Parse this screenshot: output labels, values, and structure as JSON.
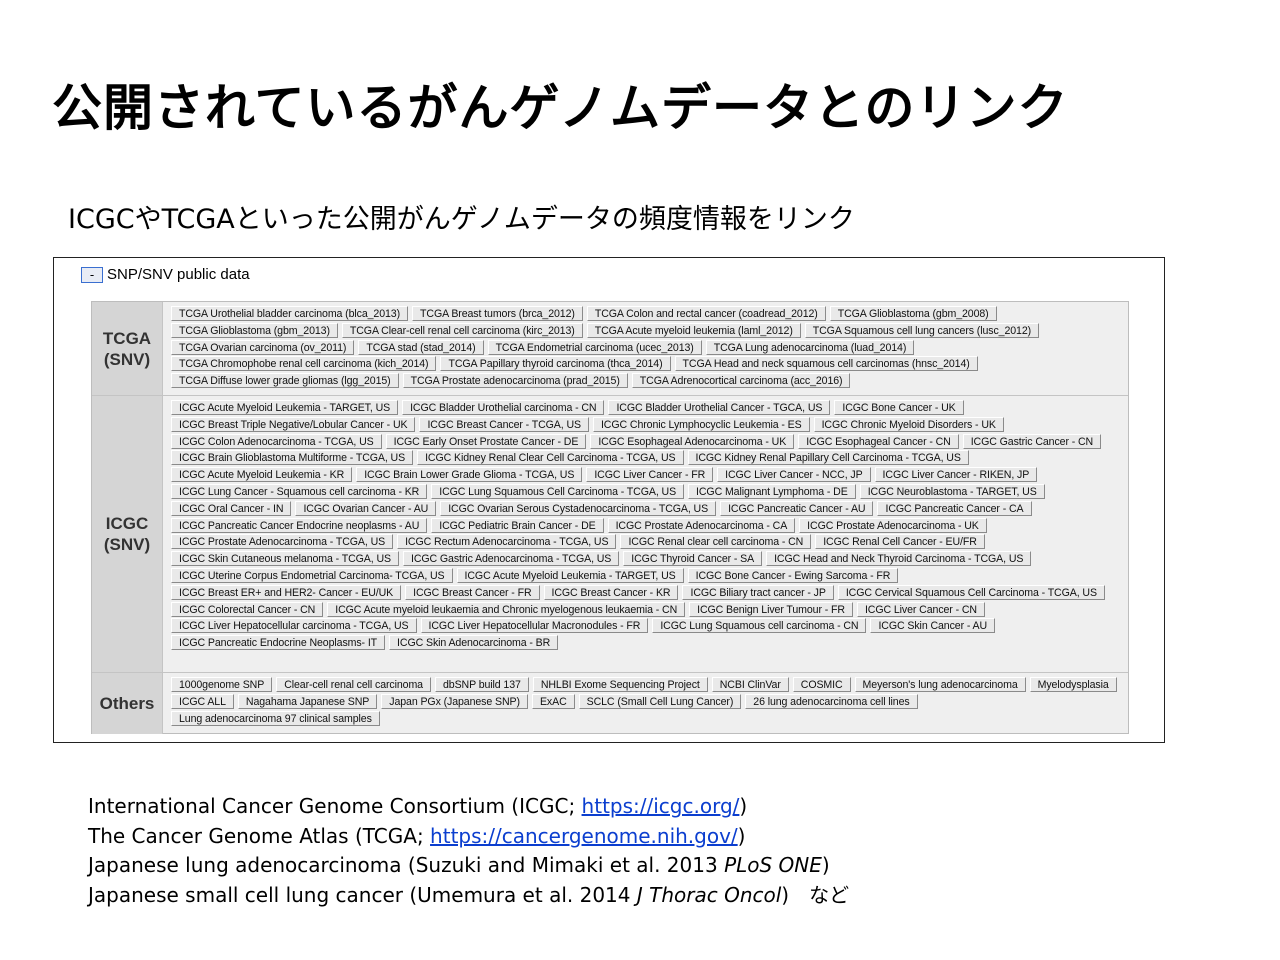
{
  "title": "公開されているがんゲノムデータとのリンク",
  "subtitle": "ICGCやTCGAといった公開がんゲノムデータの頻度情報をリンク",
  "panel": {
    "toggle_label": "-",
    "title": "SNP/SNV public data",
    "groups": [
      {
        "label": "TCGA\n(SNV)",
        "items": [
          "TCGA Urothelial bladder carcinoma (blca_2013)",
          "TCGA Breast tumors (brca_2012)",
          "TCGA Colon and rectal cancer (coadread_2012)",
          "TCGA Glioblastoma (gbm_2008)",
          "TCGA Glioblastoma (gbm_2013)",
          "TCGA Clear-cell renal cell carcinoma (kirc_2013)",
          "TCGA Acute myeloid leukemia (laml_2012)",
          "TCGA Squamous cell lung cancers (lusc_2012)",
          "TCGA Ovarian carcinoma (ov_2011)",
          "TCGA stad (stad_2014)",
          "TCGA Endometrial carcinoma (ucec_2013)",
          "TCGA Lung adenocarcinoma (luad_2014)",
          "TCGA Chromophobe renal cell carcinoma (kich_2014)",
          "TCGA Papillary thyroid carcinoma (thca_2014)",
          "TCGA Head and neck squamous cell carcinomas (hnsc_2014)",
          "TCGA Diffuse lower grade gliomas (lgg_2015)",
          "TCGA Prostate adenocarcinoma (prad_2015)",
          "TCGA Adrenocortical carcinoma (acc_2016)"
        ]
      },
      {
        "label": "ICGC\n(SNV)",
        "items": [
          "ICGC Acute Myeloid Leukemia - TARGET, US",
          "ICGC Bladder Urothelial carcinoma - CN",
          "ICGC Bladder Urothelial Cancer - TGCA, US",
          "ICGC Bone Cancer - UK",
          "ICGC Breast Triple Negative/Lobular Cancer - UK",
          "ICGC Breast Cancer - TCGA, US",
          "ICGC Chronic Lymphocyclic Leukemia - ES",
          "ICGC Chronic Myeloid Disorders - UK",
          "ICGC Colon Adenocarcinoma - TCGA, US",
          "ICGC Early Onset Prostate Cancer - DE",
          "ICGC Esophageal Adenocarcinoma - UK",
          "ICGC Esophageal Cancer - CN",
          "ICGC Gastric Cancer - CN",
          "ICGC Brain Glioblastoma Multiforme - TCGA, US",
          "ICGC Kidney Renal Clear Cell Carcinoma - TCGA, US",
          "ICGC Kidney Renal Papillary Cell Carcinoma - TCGA, US",
          "ICGC Acute Myeloid Leukemia - KR",
          "ICGC Brain Lower Grade Glioma - TCGA, US",
          "ICGC Liver Cancer - FR",
          "ICGC Liver Cancer - NCC, JP",
          "ICGC Liver Cancer - RIKEN, JP",
          "ICGC Lung Cancer - Squamous cell carcinoma - KR",
          "ICGC Lung Squamous Cell Carcinoma - TCGA, US",
          "ICGC Malignant Lymphoma - DE",
          "ICGC Neuroblastoma - TARGET, US",
          "ICGC Oral Cancer - IN",
          "ICGC Ovarian Cancer - AU",
          "ICGC Ovarian Serous Cystadenocarcinoma - TCGA, US",
          "ICGC Pancreatic Cancer - AU",
          "ICGC Pancreatic Cancer - CA",
          "ICGC Pancreatic Cancer Endocrine neoplasms - AU",
          "ICGC Pediatric Brain Cancer - DE",
          "ICGC Prostate Adenocarcinoma - CA",
          "ICGC Prostate Adenocarcinoma - UK",
          "ICGC Prostate Adenocarcinoma - TCGA, US",
          "ICGC Rectum Adenocarcinoma - TCGA, US",
          "ICGC Renal clear cell carcinoma - CN",
          "ICGC Renal Cell Cancer - EU/FR",
          "ICGC Skin Cutaneous melanoma - TCGA, US",
          "ICGC Gastric Adenocarcinoma - TCGA, US",
          "ICGC Thyroid Cancer - SA",
          "ICGC Head and Neck Thyroid Carcinoma - TCGA, US",
          "ICGC Uterine Corpus Endometrial Carcinoma- TCGA, US",
          "ICGC Acute Myeloid Leukemia - TARGET, US",
          "ICGC Bone Cancer - Ewing Sarcoma - FR",
          "ICGC Breast ER+ and HER2- Cancer - EU/UK",
          "ICGC Breast Cancer - FR",
          "ICGC Breast Cancer - KR",
          "ICGC Biliary tract cancer - JP",
          "ICGC Cervical Squamous Cell Carcinoma - TCGA, US",
          "ICGC Colorectal Cancer - CN",
          "ICGC Acute myeloid leukaemia and Chronic myelogenous leukaemia - CN",
          "ICGC Benign Liver Tumour - FR",
          "ICGC Liver Cancer - CN",
          "ICGC Liver Hepatocellular carcinoma - TCGA, US",
          "ICGC Liver Hepatocellular Macronodules - FR",
          "ICGC Lung Squamous cell carcinoma - CN",
          "ICGC Skin Cancer - AU",
          "ICGC Pancreatic Endocrine Neoplasms- IT",
          "ICGC Skin Adenocarcinoma - BR"
        ]
      },
      {
        "label": "Others",
        "items": [
          "1000genome SNP",
          "Clear-cell renal cell carcinoma",
          "dbSNP build 137",
          "NHLBI Exome Sequencing Project",
          "NCBI ClinVar",
          "COSMIC",
          "Meyerson's lung adenocarcinoma",
          "Myelodysplasia",
          "ICGC ALL",
          "Nagahama Japanese SNP",
          "Japan PGx (Japanese SNP)",
          "ExAC",
          "SCLC (Small Cell Lung Cancer)",
          "26 lung adenocarcinoma cell lines",
          "Lung adenocarcinoma 97 clinical samples"
        ]
      }
    ]
  },
  "references": [
    {
      "pre": "International Cancer Genome Consortium (ICGC; ",
      "link": "https://icgc.org/",
      "post": ")",
      "italic": "",
      "tail": ""
    },
    {
      "pre": "The Cancer Genome Atlas (TCGA; ",
      "link": "https://cancergenome.nih.gov/",
      "post": ")",
      "italic": "",
      "tail": ""
    },
    {
      "pre": "Japanese lung adenocarcinoma (Suzuki and Mimaki et al. 2013 ",
      "link": "",
      "post": "",
      "italic": "PLoS ONE",
      "tail": ")"
    },
    {
      "pre": "Japanese small cell lung cancer (Umemura et al. 2014 ",
      "link": "",
      "post": "",
      "italic": "J Thorac Oncol",
      "tail": ")　など"
    }
  ],
  "colors": {
    "link": "#0b3ecf",
    "toggle_border": "#3a6fd0",
    "row_label_bg": "#d5d5d5",
    "button_bg": "#e9e9e9"
  }
}
